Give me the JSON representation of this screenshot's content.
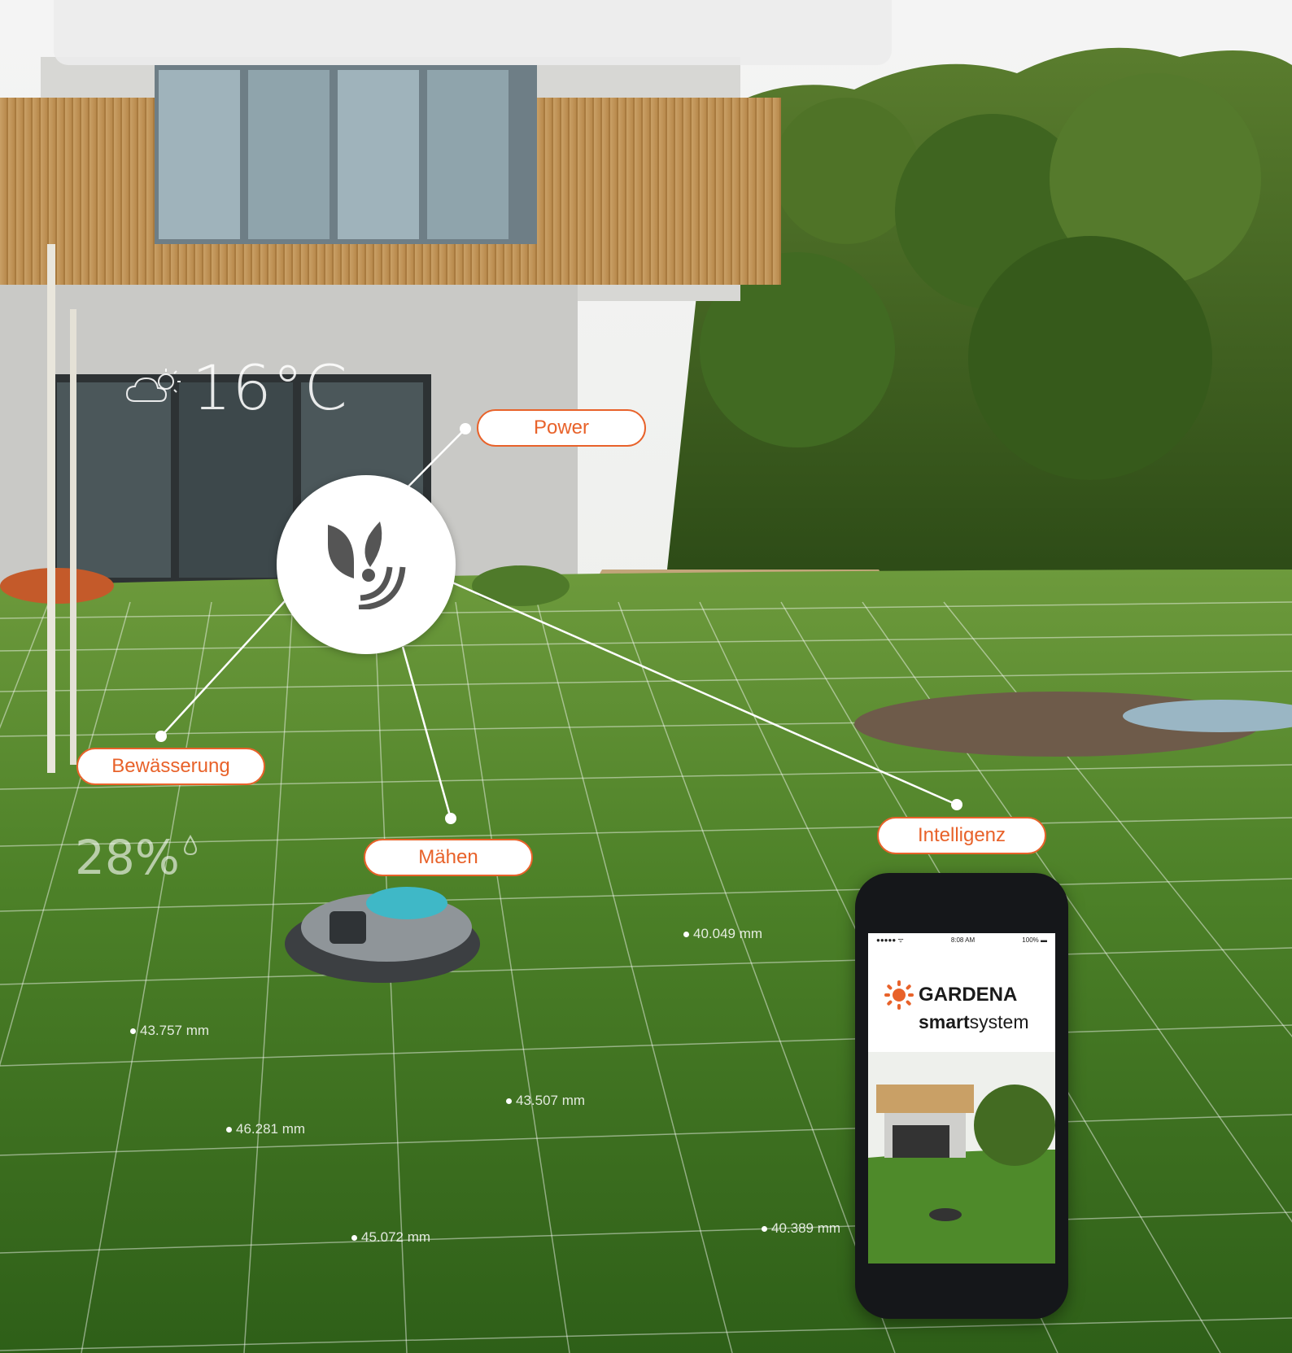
{
  "callouts": {
    "power": "Power",
    "irrigation": "Bewässerung",
    "mowing": "Mähen",
    "intelligence": "Intelligenz"
  },
  "weather": {
    "temperature": "16°C",
    "icon": "cloud-sun-icon"
  },
  "moisture": {
    "value": "28%",
    "icon": "water-drop-icon"
  },
  "measurements": [
    "43.757 mm",
    "46.281 mm",
    "43.507 mm",
    "45.072 mm",
    "40.389 mm",
    "40.049 mm"
  ],
  "phone": {
    "status_signal": "●●●●● ᯤ",
    "status_time": "8:08 AM",
    "status_battery": "100% ▬",
    "brand_name": "GARDENA",
    "brand_sub_bold": "smart",
    "brand_sub_light": "system"
  },
  "colors": {
    "accent": "#e8622a",
    "hub_icon": "#555555"
  }
}
